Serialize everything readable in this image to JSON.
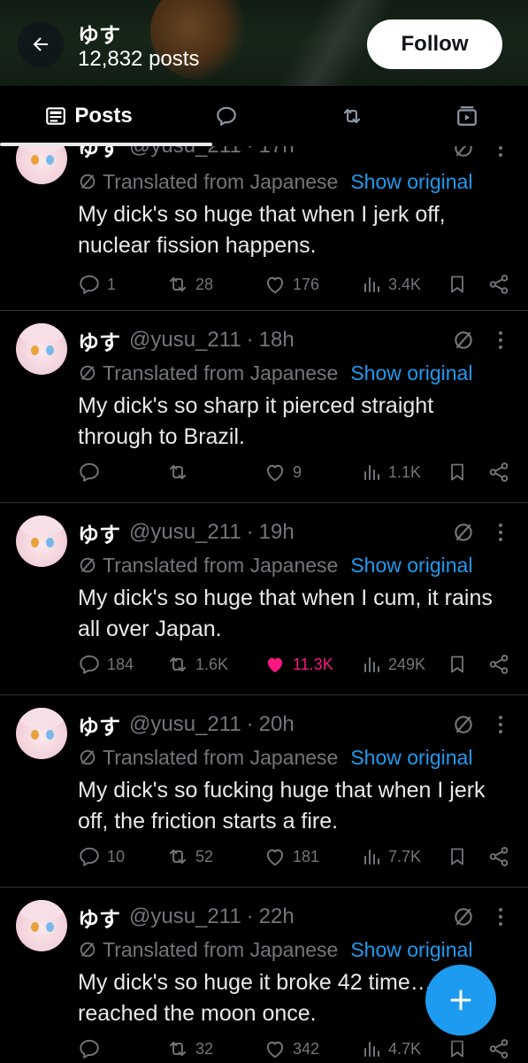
{
  "header": {
    "name": "ゆす",
    "post_count": "12,832 posts",
    "follow_label": "Follow"
  },
  "tabs": [
    {
      "label": "Posts",
      "icon": "posts-icon",
      "active": true
    },
    {
      "label": "",
      "icon": "reply-icon"
    },
    {
      "label": "",
      "icon": "retweet-icon"
    },
    {
      "label": "",
      "icon": "media-icon"
    }
  ],
  "tweet_meta": {
    "translated_label": "Translated from Japanese",
    "show_original_label": "Show original"
  },
  "tweets": [
    {
      "name": "ゆす",
      "handle": "@yusu_211",
      "time": "17h",
      "text": "My dick's so huge that when I jerk off, nuclear fission happens.",
      "replies": "1",
      "reposts": "28",
      "likes": "176",
      "views": "3.4K",
      "liked": false
    },
    {
      "name": "ゆす",
      "handle": "@yusu_211",
      "time": "18h",
      "text": "My dick's so sharp it pierced straight through to Brazil.",
      "replies": "",
      "reposts": "",
      "likes": "9",
      "views": "1.1K",
      "liked": false
    },
    {
      "name": "ゆす",
      "handle": "@yusu_211",
      "time": "19h",
      "text": "My dick's so huge that when I cum, it rains all over Japan.",
      "replies": "184",
      "reposts": "1.6K",
      "likes": "11.3K",
      "views": "249K",
      "liked": true
    },
    {
      "name": "ゆす",
      "handle": "@yusu_211",
      "time": "20h",
      "text": "My dick's so fucking huge that when I jerk off, the friction starts a fire.",
      "replies": "10",
      "reposts": "52",
      "likes": "181",
      "views": "7.7K",
      "liked": false
    },
    {
      "name": "ゆす",
      "handle": "@yusu_211",
      "time": "22h",
      "text": "My dick's so huge it broke 42 time… reached the moon once.",
      "replies": "",
      "reposts": "32",
      "likes": "342",
      "views": "4.7K",
      "liked": false
    }
  ],
  "colors": {
    "background": "#000000",
    "accent": "#1d9bf0",
    "like": "#f91880",
    "muted": "#71767b",
    "text": "#e7e9ea"
  }
}
